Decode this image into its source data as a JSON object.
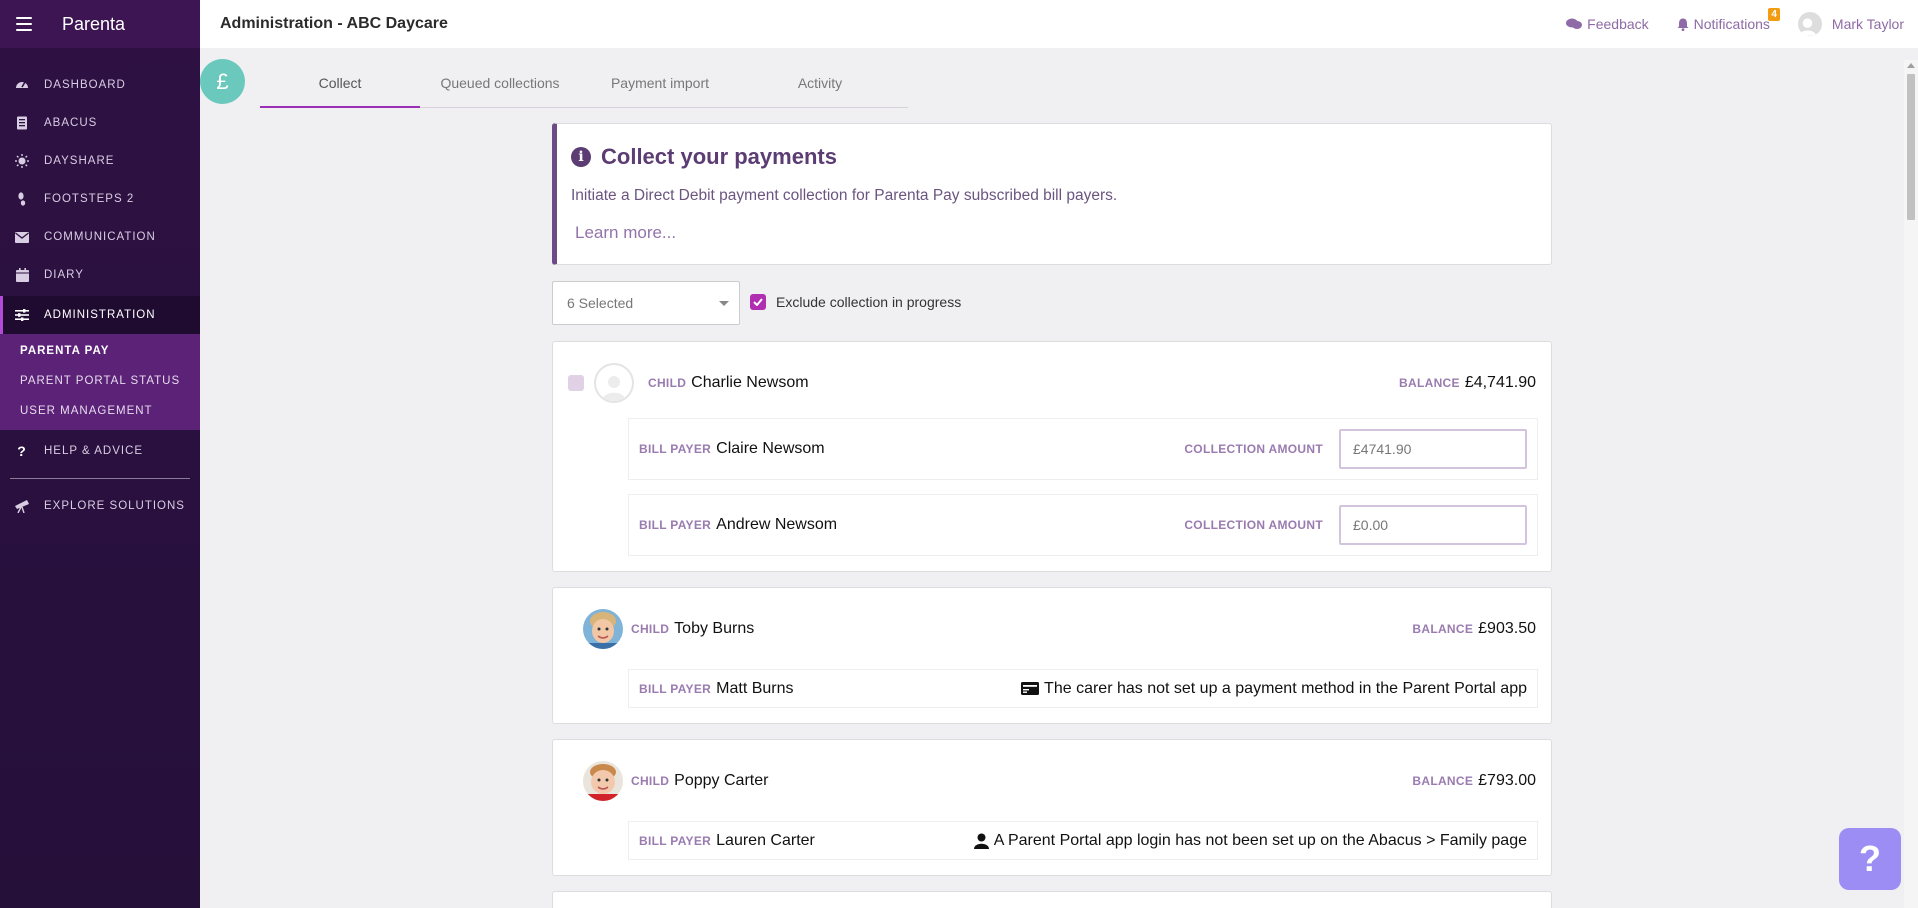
{
  "app": {
    "brand": "Parenta",
    "title": "Administration - ABC Daycare"
  },
  "topbar": {
    "feedback": "Feedback",
    "notifications": "Notifications",
    "notifications_count": "4",
    "user": "Mark Taylor"
  },
  "sidebar": {
    "items": [
      {
        "label": "DASHBOARD",
        "icon": "speedometer-icon"
      },
      {
        "label": "ABACUS",
        "icon": "document-icon"
      },
      {
        "label": "DAYSHARE",
        "icon": "sun-icon"
      },
      {
        "label": "FOOTSTEPS 2",
        "icon": "footprint-icon"
      },
      {
        "label": "COMMUNICATION",
        "icon": "envelope-icon"
      },
      {
        "label": "DIARY",
        "icon": "calendar-icon"
      },
      {
        "label": "ADMINISTRATION",
        "icon": "sliders-icon"
      }
    ],
    "sub_items": [
      "PARENTA PAY",
      "PARENT PORTAL STATUS",
      "USER MANAGEMENT"
    ],
    "help": "HELP & ADVICE",
    "explore": "EXPLORE SOLUTIONS"
  },
  "page_icon": "£",
  "tabs": [
    "Collect",
    "Queued collections",
    "Payment import",
    "Activity"
  ],
  "info": {
    "icon": "i",
    "heading": "Collect your payments",
    "text": "Initiate a Direct Debit payment collection for Parenta Pay subscribed bill payers.",
    "link": "Learn more..."
  },
  "filter": {
    "selected": "6 Selected",
    "exclude_label": "Exclude collection in progress",
    "exclude_checked": true
  },
  "labels": {
    "child": "CHILD",
    "balance": "BALANCE",
    "bill_payer": "BILL PAYER",
    "collection_amount": "COLLECTION AMOUNT"
  },
  "children": [
    {
      "name": "Charlie Newsom",
      "balance": "£4,741.90",
      "payers": [
        {
          "name": "Claire Newsom",
          "amount": "£4741.90"
        },
        {
          "name": "Andrew Newsom",
          "amount": "£0.00"
        }
      ]
    },
    {
      "name": "Toby Burns",
      "balance": "£903.50",
      "payers": [
        {
          "name": "Matt Burns",
          "message": "The carer has not set up a payment method in the Parent Portal app",
          "icon": "credit-card-icon"
        }
      ]
    },
    {
      "name": "Poppy Carter",
      "balance": "£793.00",
      "payers": [
        {
          "name": "Lauren Carter",
          "message": "A Parent Portal app login has not been set up on the Abacus > Family page",
          "icon": "user-icon"
        }
      ]
    }
  ],
  "help_button": "?",
  "colors": {
    "sidebar": "#2e1143",
    "accent": "#9c2fb7",
    "label": "#9a7bb0",
    "pound_badge": "#6bc8bd",
    "help_button": "#9b8df3"
  }
}
